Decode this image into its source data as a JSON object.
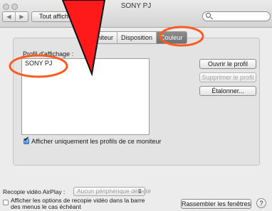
{
  "window": {
    "title": "SONY PJ"
  },
  "toolbar": {
    "back_glyph": "◀",
    "forward_glyph": "▶",
    "show_all_label": "Tout afficher"
  },
  "tabs": [
    {
      "label": "Moniteur",
      "selected": false
    },
    {
      "label": "Disposition",
      "selected": false
    },
    {
      "label": "Couleur",
      "selected": true
    }
  ],
  "color_tab": {
    "profile_label": "Profil d'affichage :",
    "profiles": [
      {
        "name": "SONY PJ",
        "selected": true
      }
    ],
    "open_profile_button": "Ouvrir le profil",
    "delete_profile_button": "Supprimer le profil",
    "calibrate_button": "Étalonner...",
    "only_this_monitor_checkbox": {
      "label": "Afficher uniquement les profils de ce moniteur",
      "checked": true
    }
  },
  "airplay": {
    "label": "Recopie vidéo AirPlay :",
    "popup_value": "Aucun périphérique détecté",
    "popup_arrow": "⇕"
  },
  "footer": {
    "show_mirroring_options": {
      "label_line1": "Afficher les options de recopie vidéo dans la barre",
      "label_line2": "des menus le cas échéant",
      "checked": false
    },
    "gather_windows_button": "Rassembler les fenêtres",
    "help_glyph": "?"
  },
  "colors": {
    "annotation_red": "#ff1a1a",
    "selected_tab_bg": "#7b7b7b"
  }
}
